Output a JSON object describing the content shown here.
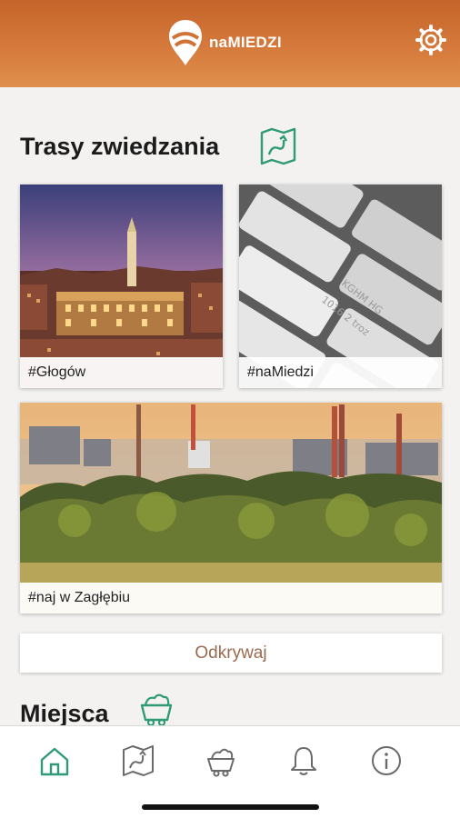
{
  "header": {
    "app_name": "naMIEDZI",
    "logo_icon": "map-pin-logo-icon",
    "settings_icon": "gear-icon"
  },
  "routes": {
    "title": "Trasy zwiedzania",
    "icon": "map-route-icon",
    "cards": [
      {
        "label": "#Głogów"
      },
      {
        "label": "#naMiedzi"
      },
      {
        "label": "#naj w Zagłębiu"
      }
    ],
    "discover_label": "Odkrywaj"
  },
  "places": {
    "title": "Miejsca",
    "icon": "mine-cart-icon"
  },
  "tabbar": {
    "items": [
      {
        "icon": "home-icon",
        "active": true
      },
      {
        "icon": "map-route-icon",
        "active": false
      },
      {
        "icon": "mine-cart-icon",
        "active": false
      },
      {
        "icon": "bell-icon",
        "active": false
      },
      {
        "icon": "info-icon",
        "active": false
      }
    ]
  },
  "colors": {
    "header": "#d06f33",
    "accent": "#2e9b76",
    "button_text": "#9a6a50"
  }
}
